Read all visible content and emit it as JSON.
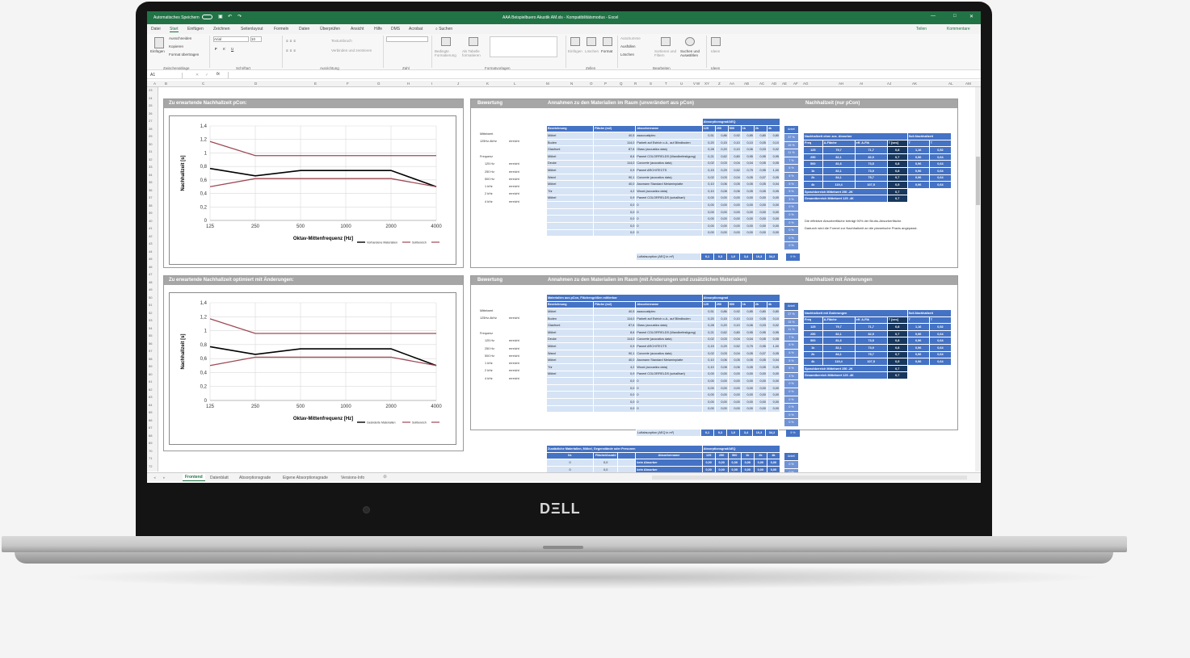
{
  "window": {
    "autosave": "Automatisches Speichern",
    "title": "AAA Beispielbuero Akustik AM.xls  -  Kompatibilitätsmodus  -  Excel",
    "teilen": "Teilen",
    "kommentare": "Kommentare"
  },
  "menu": [
    "Datei",
    "Start",
    "Einfügen",
    "Zeichnen",
    "Seitenlayout",
    "Formeln",
    "Daten",
    "Überprüfen",
    "Ansicht",
    "Hilfe",
    "DMS",
    "Acrobat",
    "Suchen"
  ],
  "ribbon": {
    "clipboard": {
      "paste": "Einfügen",
      "cut": "Ausschneiden",
      "copy": "Kopieren",
      "format": "Format übertragen",
      "group": "Zwischenablage"
    },
    "font": {
      "name": "Arial",
      "size": "10",
      "group": "Schriftart"
    },
    "align": {
      "wrap": "Textumbruch",
      "merge": "Verbinden und zentrieren",
      "group": "Ausrichtung"
    },
    "number": {
      "group": "Zahl"
    },
    "styles": {
      "cond": "Bedingte Formatierung",
      "table": "Als Tabelle formatieren",
      "group": "Formatvorlagen"
    },
    "cells": {
      "insert": "Einfügen",
      "delete": "Löschen",
      "format": "Format",
      "group": "Zellen"
    },
    "editing": {
      "autosum": "AutoSumme",
      "fill": "Ausfüllen",
      "clear": "Löschen",
      "sort": "Sortieren und Filtern",
      "find": "Suchen und Auswählen",
      "group": "Bearbeiten"
    },
    "ideas": {
      "label": "Ideen",
      "group": "Ideen"
    }
  },
  "formula": {
    "cell": "A1",
    "fx": "fx"
  },
  "columns": [
    "A",
    "B",
    "C",
    "D",
    "E",
    "F",
    "G",
    "H",
    "I",
    "J",
    "K",
    "L",
    "M",
    "N",
    "O",
    "P",
    "Q",
    "R",
    "S",
    "T",
    "U",
    "V",
    "W",
    "X",
    "Y",
    "Z",
    "AA",
    "AB",
    "AC",
    "AD",
    "AE",
    "AF",
    "AG",
    "AH",
    "AI",
    "AJ",
    "AK",
    "AL",
    "AM",
    "AN"
  ],
  "rows": [
    "23",
    "24",
    "25",
    "26",
    "27",
    "28",
    "29",
    "30",
    "31",
    "32",
    "33",
    "34",
    "35",
    "36",
    "37",
    "38",
    "39",
    "40",
    "41",
    "42",
    "43",
    "44",
    "45",
    "46",
    "47",
    "48",
    "49",
    "50",
    "51",
    "52",
    "53",
    "54",
    "55",
    "56",
    "57",
    "58",
    "59",
    "60",
    "61",
    "62",
    "63",
    "64",
    "65",
    "66",
    "67",
    "68",
    "69",
    "70",
    "71",
    "72"
  ],
  "tabs": [
    "Frontend",
    "Datenblatt",
    "Absorptionsgrade",
    "Eigene Absorptionsgrade",
    "Versions-Info"
  ],
  "colors": {
    "excel_green": "#217346",
    "blue": "#4472c4",
    "light": "#d5e3f5",
    "dark": "#17375e",
    "black_line": "#000000",
    "red_line": "#9e4a55"
  },
  "chart1": {
    "title": "Zu erwartende Nachhallzeit pCon:",
    "legend": [
      "Vorhandene Materialien",
      "Sollbereich",
      ""
    ]
  },
  "chart2": {
    "title": "Zu erwartende Nachhallzeit optimiert mit Änderungen:",
    "legend": [
      "Geänderte Materialien",
      "Sollbereich",
      ""
    ]
  },
  "chart_data": [
    {
      "type": "line",
      "title": "",
      "xlabel": "Oktav-Mittenfrequenz [Hz]",
      "ylabel": "Nachhallzeit [s]",
      "categories": [
        "125",
        "250",
        "500",
        "1000",
        "2000",
        "4000"
      ],
      "ylim": [
        0,
        1.4
      ],
      "yticks": [
        "0",
        "0,2",
        "0,4",
        "0,6",
        "0,8",
        "1",
        "1,2",
        "1,4"
      ],
      "series": [
        {
          "name": "Vorhandene Materialien",
          "values": [
            0.77,
            0.66,
            0.74,
            0.74,
            0.74,
            0.5
          ]
        },
        {
          "name": "Sollbereich",
          "values": [
            1.17,
            0.96,
            0.96,
            0.96,
            0.96,
            0.96
          ]
        },
        {
          "name": "",
          "values": [
            0.5,
            0.62,
            0.62,
            0.62,
            0.62,
            0.5
          ]
        }
      ]
    },
    {
      "type": "line",
      "title": "",
      "xlabel": "Oktav-Mittenfrequenz [Hz]",
      "ylabel": "Nachhallzeit [s]",
      "categories": [
        "125",
        "250",
        "500",
        "1000",
        "2000",
        "4000"
      ],
      "ylim": [
        0,
        1.4
      ],
      "yticks": [
        "0",
        "0,2",
        "0,4",
        "0,6",
        "0,8",
        "1",
        "1,2",
        "1,4"
      ],
      "series": [
        {
          "name": "Geänderte Materialien",
          "values": [
            0.77,
            0.66,
            0.74,
            0.74,
            0.74,
            0.5
          ]
        },
        {
          "name": "Sollbereich",
          "values": [
            1.17,
            0.96,
            0.96,
            0.96,
            0.96,
            0.96
          ]
        },
        {
          "name": "",
          "values": [
            0.5,
            0.62,
            0.62,
            0.62,
            0.62,
            0.5
          ]
        }
      ]
    }
  ],
  "sec1": {
    "bewertung": "Bewertung",
    "materials_title": "Annahmen zu den Materialien im Raum (unverändert aus pCon)",
    "nach_title": "Nachhallzeit (nur pCon)",
    "group_header": "Absorptionsgrad/AEQ",
    "anteil": "Anteil",
    "headers": [
      "Bezeichnung",
      "Fläche (m2)",
      "Absorbername",
      "125",
      "250",
      "500",
      "1k",
      "2k",
      "4k"
    ],
    "eval_labels": [
      [
        "Mittelwert",
        ""
      ],
      [
        "125Hz-4kHz",
        "erreicht"
      ],
      [
        "",
        ""
      ],
      [
        "Frequenz",
        ""
      ],
      [
        "125 Hz",
        "erreicht"
      ],
      [
        "250 Hz",
        "erreicht"
      ],
      [
        "500 Hz",
        "erreicht"
      ],
      [
        "1 kHz",
        "erreicht"
      ],
      [
        "2 kHz",
        "erreicht"
      ],
      [
        "4 kHz",
        "erreicht"
      ]
    ],
    "rows": [
      [
        "Möbel",
        "40,5",
        "asacoustiplec",
        "0,51",
        "0,86",
        "0,92",
        "0,85",
        "0,80",
        "0,80"
      ],
      [
        "Boden",
        "114,0",
        "Parkett auf Estrich o.A., auf Blindboden",
        "0,20",
        "0,15",
        "0,10",
        "0,10",
        "0,05",
        "0,10"
      ],
      [
        "Glasfront",
        "87,6",
        "Glass (acoustics data)",
        "0,28",
        "0,20",
        "0,10",
        "0,06",
        "0,03",
        "0,02"
      ],
      [
        "Möbel",
        "8,6",
        "Paneel COLORFIELDS (Wandbefestigung)",
        "0,21",
        "0,62",
        "0,80",
        "0,95",
        "0,95",
        "0,95"
      ],
      [
        "Decke",
        "114,0",
        "Concrete (acoustics data)",
        "0,02",
        "0,03",
        "0,04",
        "0,04",
        "0,05",
        "0,05"
      ],
      [
        "Möbel",
        "0,9",
        "Paneel ARCHITECTS",
        "0,15",
        "0,29",
        "0,52",
        "0,79",
        "0,95",
        "1,00"
      ],
      [
        "Wand",
        "90,1",
        "Concrete (acoustics data)",
        "0,02",
        "0,03",
        "0,04",
        "0,05",
        "0,07",
        "0,05"
      ],
      [
        "Möbel",
        "40,0",
        "Assmann Standard Melaminplatte",
        "0,10",
        "0,06",
        "0,05",
        "0,05",
        "0,05",
        "0,04"
      ],
      [
        "Tür",
        "4,2",
        "Wood (acoustics data)",
        "0,10",
        "0,08",
        "0,06",
        "0,05",
        "0,05",
        "0,05"
      ],
      [
        "Möbel",
        "0,9",
        "Paneel COLORFIELDS (schallhart)",
        "0,00",
        "0,00",
        "0,00",
        "0,00",
        "0,00",
        "0,00"
      ],
      [
        "",
        "0,0",
        "0",
        "0,00",
        "0,00",
        "0,00",
        "0,00",
        "0,00",
        "0,00"
      ],
      [
        "",
        "0,0",
        "0",
        "0,00",
        "0,00",
        "0,00",
        "0,00",
        "0,00",
        "0,00"
      ],
      [
        "",
        "0,0",
        "0",
        "0,00",
        "0,00",
        "0,00",
        "0,00",
        "0,00",
        "0,00"
      ],
      [
        "",
        "0,0",
        "0",
        "0,00",
        "0,00",
        "0,00",
        "0,00",
        "0,00",
        "0,00"
      ],
      [
        "",
        "0,0",
        "0",
        "0,00",
        "0,00",
        "0,00",
        "0,00",
        "0,00",
        "0,00"
      ]
    ],
    "anteil_values": [
      "37 %",
      "15 %",
      "11 %",
      "7 %",
      "6 %",
      "6 %",
      "5 %",
      "5 %",
      "3 %",
      "0 %",
      "0 %",
      "0 %",
      "0 %",
      "0 %",
      "0 %"
    ],
    "luft": {
      "label": "Luftabsorption (AEQ in m²)",
      "values": [
        "0,1",
        "0,3",
        "1,0",
        "3,4",
        "10,3",
        "34,2"
      ],
      "anteil": "9 %"
    },
    "rt": {
      "header": "Nachhallzeit ohne zus. Absorber",
      "soll": "Soll-Nachhallzeit",
      "cols": [
        "Freq",
        "A-Fläche",
        "eff. A-Flä",
        "T [sec]",
        "T",
        "T"
      ],
      "rows": [
        [
          "125",
          "79,7",
          "71,7",
          "0,8",
          "1,16",
          "0,52"
        ],
        [
          "250",
          "82,1",
          "82,9",
          "0,7",
          "0,96",
          "0,64"
        ],
        [
          "500",
          "81,6",
          "73,5",
          "0,8",
          "0,96",
          "0,64"
        ],
        [
          "1k",
          "82,1",
          "73,9",
          "0,8",
          "0,96",
          "0,64"
        ],
        [
          "2k",
          "84,1",
          "75,7",
          "0,7",
          "0,96",
          "0,64"
        ],
        [
          "4k",
          "119,4",
          "107,5",
          "0,5",
          "0,96",
          "0,64"
        ]
      ],
      "sprach": "Sprachbereich Mittelwert 250 -2K",
      "sprach_val": "0,7",
      "gesamt": "Gesamtbereich Mittelwert 125 -4K",
      "gesamt_val": "0,7"
    },
    "note1": "Die effektive Absorberfläche beträgt 90% der Brutto-Absorberfläche.",
    "note2": "Dadurch wird die Formel zur Nachhallzeit an die planerische Praxis angepasst."
  },
  "sec2": {
    "bewertung": "Bewertung",
    "materials_title": "Annahmen zu den Materialien im Raum (mit Änderungen und zusätzlichen Materialien)",
    "nach_title": "Nachhallzeit mit Änderungen",
    "table_title": "Materialien aus pCon, Flächengrößen editierbar",
    "group_header": "Absorptionsgrad",
    "anteil": "Anteil",
    "rt": {
      "header": "Nachhallzeit mit Änderungen",
      "soll": "Soll-Nachhallzeit",
      "rows": [
        [
          "125",
          "79,7",
          "71,7",
          "0,8",
          "1,16",
          "0,52"
        ],
        [
          "250",
          "82,1",
          "82,9",
          "0,7",
          "0,96",
          "0,64"
        ],
        [
          "500",
          "81,6",
          "73,5",
          "0,8",
          "0,96",
          "0,64"
        ],
        [
          "1k",
          "82,1",
          "73,9",
          "0,8",
          "0,96",
          "0,64"
        ],
        [
          "2k",
          "84,1",
          "75,7",
          "0,7",
          "0,96",
          "0,64"
        ],
        [
          "4k",
          "119,4",
          "107,5",
          "0,5",
          "0,96",
          "0,64"
        ]
      ],
      "sprach": "Sprachbereich Mittelwert 250 -2K",
      "sprach_val": "0,7",
      "gesamt": "Gesamtbereich Mittelwert 125 -4K",
      "gesamt_val": "0,7"
    },
    "luft": {
      "label": "Luftabsorption (AEQ in m²)",
      "values": [
        "0,1",
        "0,3",
        "1,0",
        "3,4",
        "10,3",
        "34,2"
      ],
      "anteil": "9 %"
    }
  },
  "sec3": {
    "title": "Zusätzliche Materialien, Möbel, Gegenstände oder Personen",
    "group_header": "Absorptionsgrad/AEQ",
    "headers": [
      "Nr.",
      "Fläche/Anzahl",
      "",
      "Absorbername",
      "125",
      "250",
      "500",
      "1k",
      "2k",
      "4k"
    ],
    "anteil": "Anteil",
    "rows": [
      [
        "0",
        "0,0",
        "",
        "kein Absorber",
        "0,00",
        "0,00",
        "0,00",
        "0,00",
        "0,00",
        "0,00"
      ],
      [
        "0",
        "0,0",
        "",
        "kein Absorber",
        "0,00",
        "0,00",
        "0,00",
        "0,00",
        "0,00",
        "0,00"
      ]
    ],
    "anteil_values": [
      "0 %",
      "0 %"
    ]
  }
}
